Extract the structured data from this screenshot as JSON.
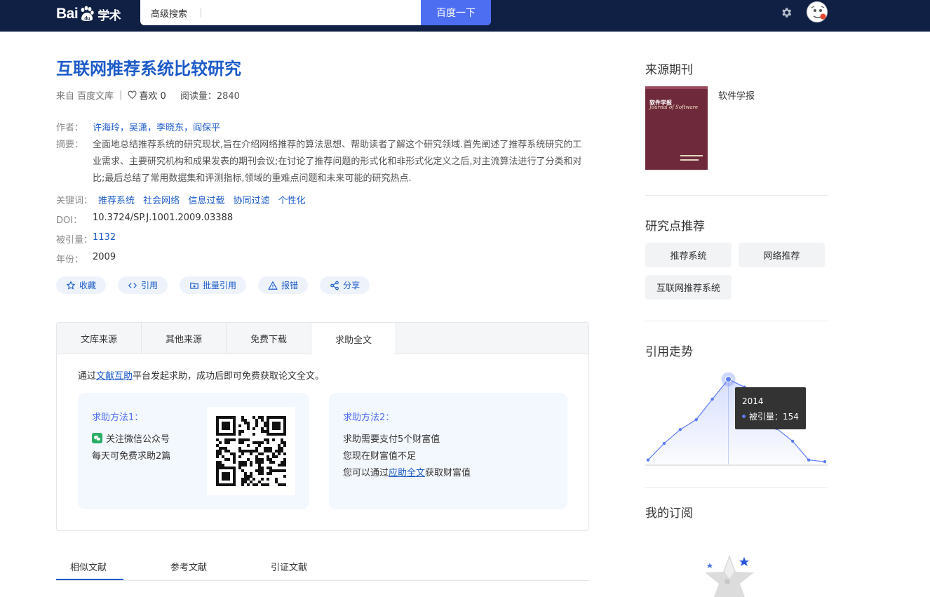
{
  "header": {
    "logo_text": "Bai",
    "logo_du": "du",
    "logo_suffix": "学术",
    "search_advanced": "高级搜索",
    "search_value": "",
    "search_button": "百度一下"
  },
  "paper": {
    "title": "互联网推荐系统比较研究",
    "source_prefix": "来自",
    "source": "百度文库",
    "likes": "喜欢 0",
    "reads": "阅读量：2840",
    "fields": {
      "author_label": "作者：",
      "authors": [
        "许海玲",
        "吴潇",
        "李晓东",
        "阎保平"
      ],
      "abstract_label": "摘要：",
      "abstract": "全面地总结推荐系统的研究现状,旨在介绍网络推荐的算法思想、帮助读者了解这个研究领域.首先阐述了推荐系统研究的工业需求、主要研究机构和成果发表的期刊会议;在讨论了推荐问题的形式化和非形式化定义之后,对主流算法进行了分类和对比;最后总结了常用数据集和评测指标,领域的重难点问题和未来可能的研究热点.",
      "keywords_label": "关键词：",
      "keywords": [
        "推荐系统",
        "社会网络",
        "信息过载",
        "协同过滤",
        "个性化"
      ],
      "doi_label": "DOI：",
      "doi": "10.3724/SP.J.1001.2009.03388",
      "cited_label": "被引量：",
      "cited": "1132",
      "year_label": "年份：",
      "year": "2009"
    },
    "actions": [
      "收藏",
      "引用",
      "批量引用",
      "报错",
      "分享"
    ]
  },
  "panel": {
    "tabs": [
      "文库来源",
      "其他来源",
      "免费下载",
      "求助全文"
    ],
    "active_tab": 3,
    "help_prefix": "通过",
    "help_link": "文献互助",
    "help_suffix": "平台发起求助，成功后即可免费获取论文全文。",
    "method1": {
      "title": "求助方法1：",
      "line1": "关注微信公众号",
      "line2": "每天可免费求助2篇"
    },
    "method2": {
      "title": "求助方法2：",
      "line1": "求助需要支付5个财富值",
      "line2": "您现在财富值不足",
      "line3_prefix": "您可以通过",
      "line3_link": "应助全文",
      "line3_suffix": "获取财富值"
    }
  },
  "bottom_tabs": [
    "相似文献",
    "参考文献",
    "引证文献"
  ],
  "sidebar": {
    "journal_heading": "来源期刊",
    "journal_name": "软件学报",
    "cover_cn": "软件学报",
    "cover_en": "Journal of Software",
    "topics_heading": "研究点推荐",
    "topics": [
      "推荐系统",
      "网络推荐",
      "互联网推荐系统"
    ],
    "trend_heading": "引用走势",
    "tooltip_year": "2014",
    "tooltip_label": "被引量：154",
    "subscribe_heading": "我的订阅"
  },
  "chart_data": {
    "type": "area",
    "series": [
      {
        "values": [
          8,
          38,
          63,
          81,
          118,
          154,
          140,
          125,
          65,
          42,
          8,
          5
        ]
      }
    ],
    "highlight_index": 5,
    "highlight_value": 154,
    "ylim": [
      0,
      170
    ],
    "color": "#5d7cf5"
  },
  "colors": {
    "header_bg": "#0f2044",
    "accent": "#4e6ef2",
    "link": "#1c5bc8"
  }
}
